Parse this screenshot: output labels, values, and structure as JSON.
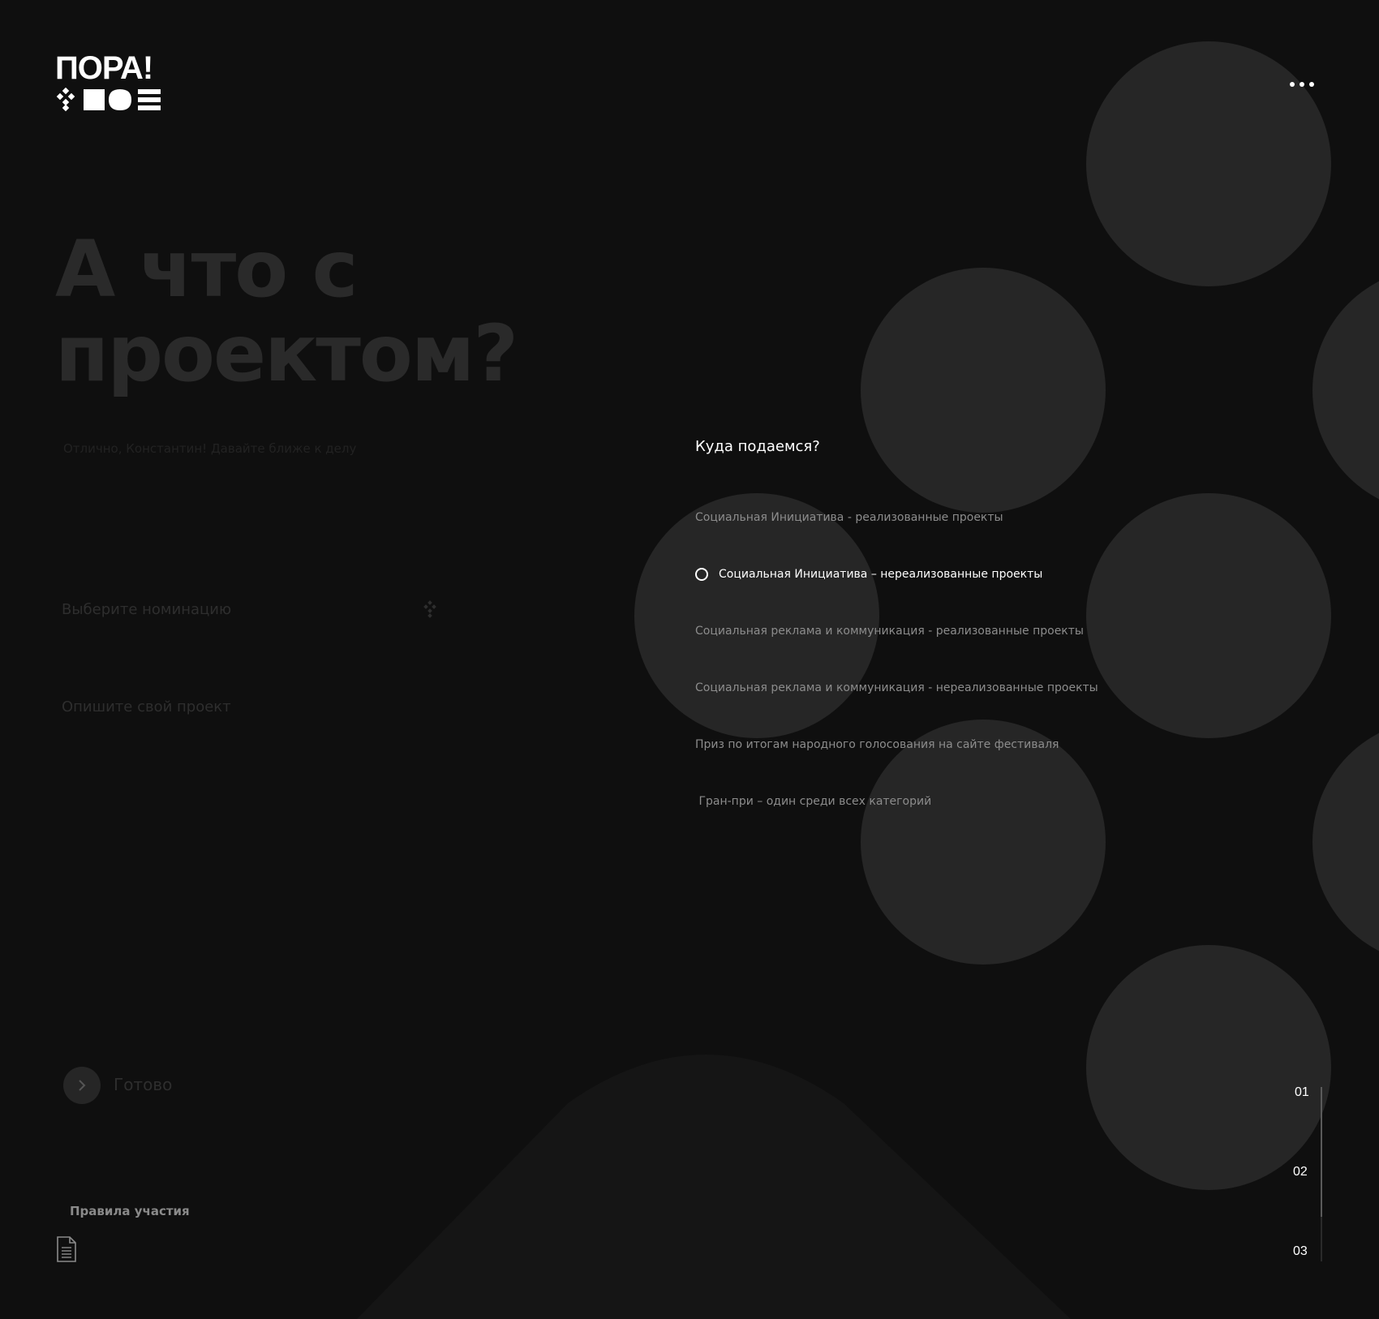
{
  "brand": {
    "name": "ПОРА!"
  },
  "menu": {
    "icon": "more-dots-icon"
  },
  "heading": {
    "line1": "А что с",
    "line2": "проектом?",
    "subtitle": "Отлично, Константин! Давайте ближе к делу"
  },
  "form": {
    "nomination_placeholder": "Выберите номинацию",
    "description_placeholder": "Опишите свой проект",
    "done_label": "Готово"
  },
  "footer": {
    "rules_label": "Правила участия",
    "doc_icon": "document-icon"
  },
  "nomination_panel": {
    "question": "Куда подаемся?",
    "options": [
      {
        "label": "Социальная Инициатива - реализованные проекты",
        "selected": false
      },
      {
        "label": "Социальная Инициатива – нереализованные проекты",
        "selected": true
      },
      {
        "label": "Социальная реклама и коммуникация - реализованные проекты",
        "selected": false
      },
      {
        "label": "Социальная реклама и коммуникация - нереализованные проекты",
        "selected": false
      },
      {
        "label": "Приз по итогам народного голосования на сайте фестиваля",
        "selected": false
      },
      {
        "label": " Гран-при – один среди всех категорий",
        "selected": false
      }
    ]
  },
  "steps": [
    "01",
    "02",
    "03"
  ],
  "current_step": "01",
  "colors": {
    "background": "#0f0f0f",
    "circle": "#262626",
    "accent": "#ffffff",
    "muted_text": "#8c8c8c"
  }
}
